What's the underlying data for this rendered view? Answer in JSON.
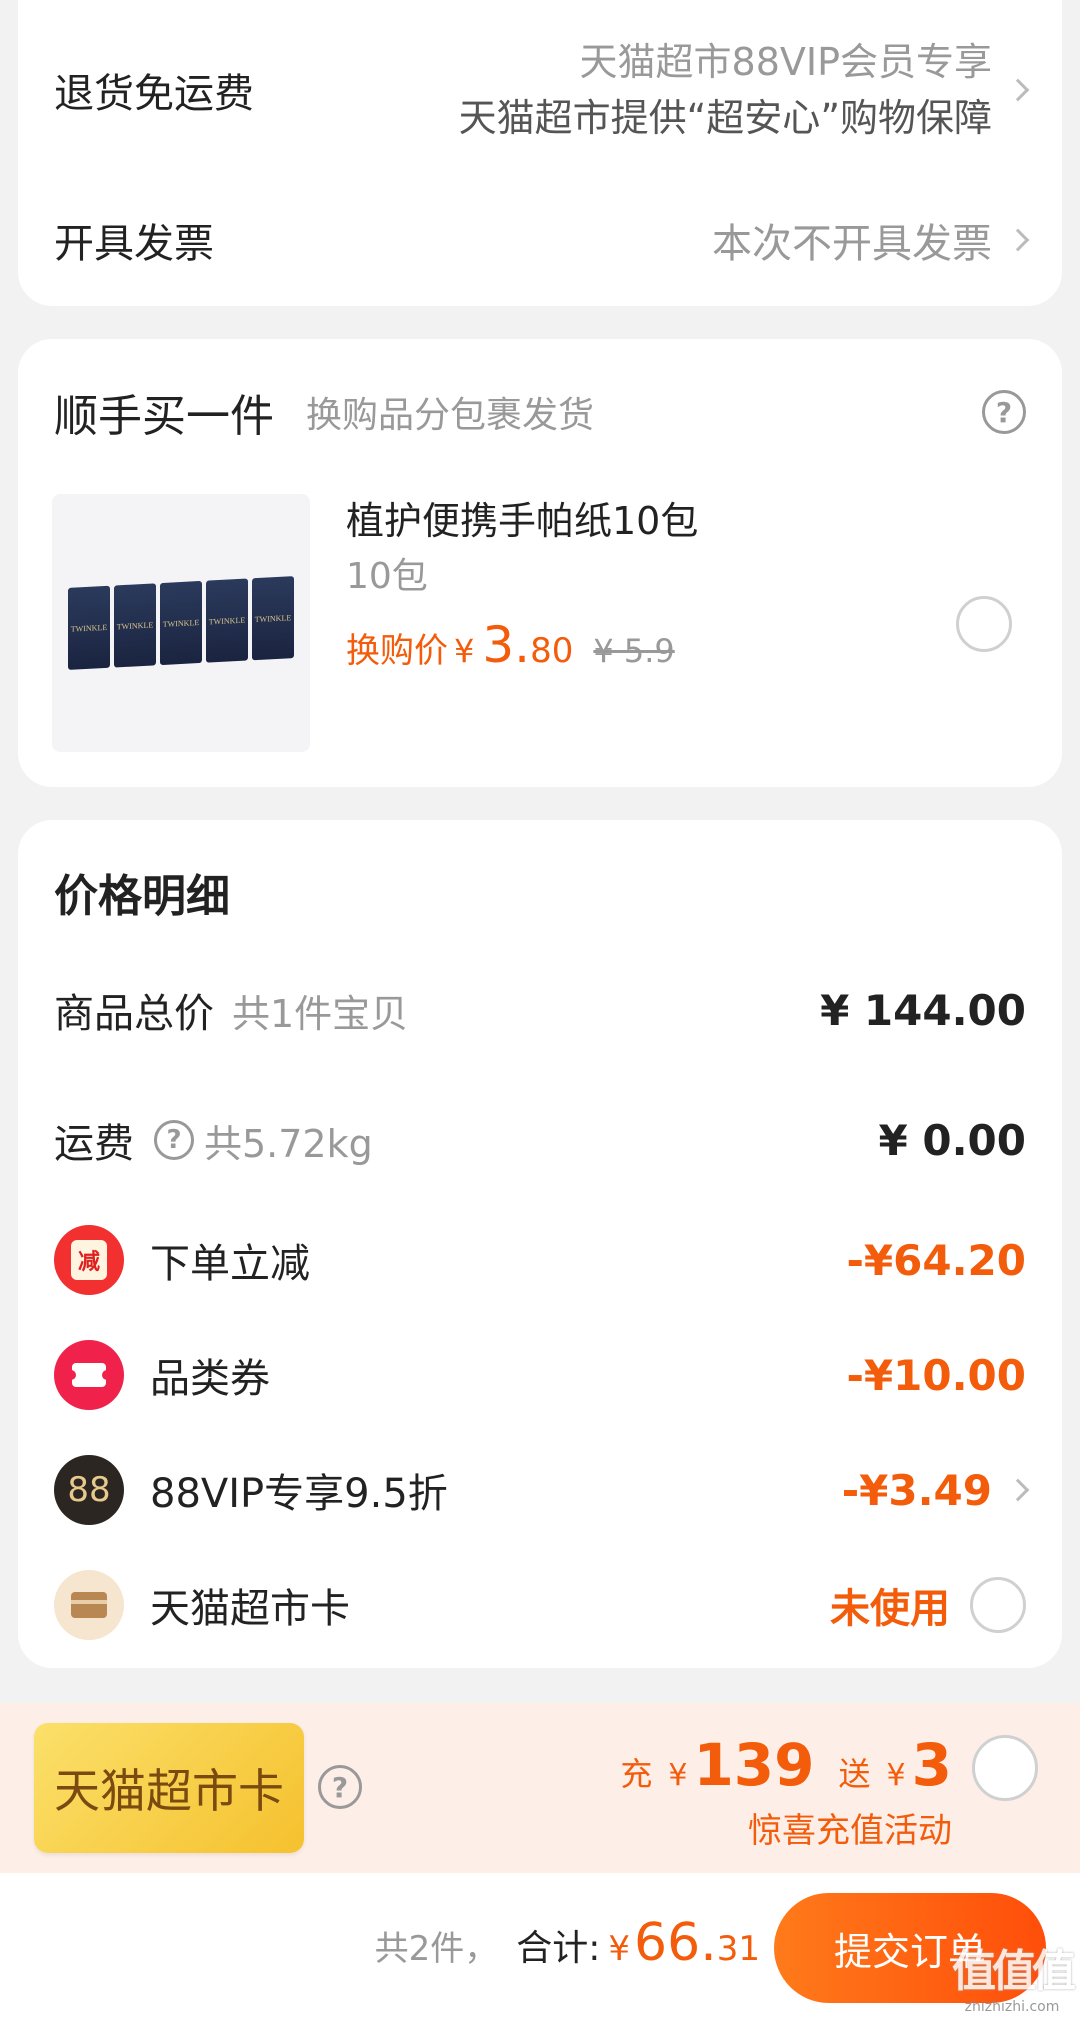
{
  "return_shipping": {
    "label": "退货免运费",
    "line1": "天猫超市88VIP会员专享",
    "line2": "天猫超市提供“超安心”购物保障"
  },
  "invoice": {
    "label": "开具发票",
    "value": "本次不开具发票"
  },
  "addon": {
    "title": "顺手买一件",
    "subtitle": "换购品分包裹发货",
    "product": {
      "name": "植护便携手帕纸10包",
      "spec": "10包",
      "price_label": "换购价",
      "currency": "¥",
      "price_int": "3.",
      "price_dec": "80",
      "original_price": "¥ 5.9",
      "pack_text": "TWINKLE"
    }
  },
  "price_detail": {
    "title": "价格明细",
    "goods_total": {
      "label": "商品总价",
      "note": "共1件宝贝",
      "value": "¥ 144.00"
    },
    "shipping": {
      "label": "运费",
      "note": "共5.72kg",
      "value": "¥ 0.00"
    },
    "order_discount": {
      "icon_text": "减",
      "label": "下单立减",
      "value": "-¥64.20"
    },
    "category_coupon": {
      "label": "品类券",
      "value": "-¥10.00"
    },
    "vip_discount": {
      "icon_text": "88",
      "label": "88VIP专享9.5折",
      "value": "-¥3.49"
    },
    "supermarket_card": {
      "label": "天猫超市卡",
      "value": "未使用"
    }
  },
  "recharge": {
    "card_label": "天猫超市卡",
    "charge_word": "充",
    "charge_currency": "¥",
    "charge_amount": "139",
    "gift_word": "送",
    "gift_currency": "¥",
    "gift_amount": "3",
    "activity": "惊喜充值活动"
  },
  "footer": {
    "count": "共2件，",
    "total_label": "合计:",
    "currency": "¥",
    "total_int": "66.",
    "total_dec": "31",
    "submit": "提交订单",
    "watermark": "值值值",
    "watermark_url": "zhizhizhi.com"
  },
  "colors": {
    "accent": "#f25c0a",
    "submit_start": "#ff7a1a",
    "submit_end": "#ff4e0a",
    "recharge_bg": "#fdeee8",
    "card_gold": "#f7c836"
  }
}
